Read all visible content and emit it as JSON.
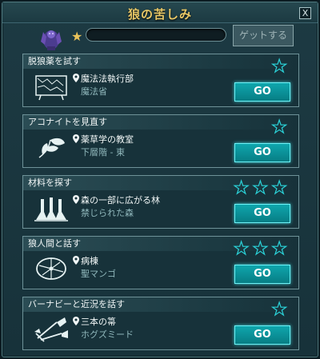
{
  "window": {
    "title": "狼の苦しみ",
    "close_label": "X"
  },
  "header": {
    "get_button_label": "ゲットする",
    "star_glyph": "★",
    "progress_percent": 0
  },
  "quests": [
    {
      "title": "脱狼薬を試す",
      "location": "魔法法執行部",
      "sublocation": "魔法省",
      "icon": "map-icon",
      "stars": 1,
      "go_label": "GO"
    },
    {
      "title": "アコナイトを見直す",
      "location": "薬草学の教室",
      "sublocation": "下層階 - 東",
      "icon": "leaf-icon",
      "stars": 1,
      "go_label": "GO"
    },
    {
      "title": "材料を探す",
      "location": "森の一部に広がる林",
      "sublocation": "禁じられた森",
      "icon": "flask-icon",
      "stars": 3,
      "go_label": "GO"
    },
    {
      "title": "狼人間と話す",
      "location": "病棟",
      "sublocation": "聖マンゴ",
      "icon": "wheel-icon",
      "stars": 3,
      "go_label": "GO"
    },
    {
      "title": "バーナビーと近況を話す",
      "location": "三本の箒",
      "sublocation": "ホグズミード",
      "icon": "brooms-icon",
      "stars": 1,
      "go_label": "GO"
    }
  ],
  "colors": {
    "accent": "#0fa6ad",
    "title": "#e8c766",
    "star_outline": "#2bd2d8"
  }
}
